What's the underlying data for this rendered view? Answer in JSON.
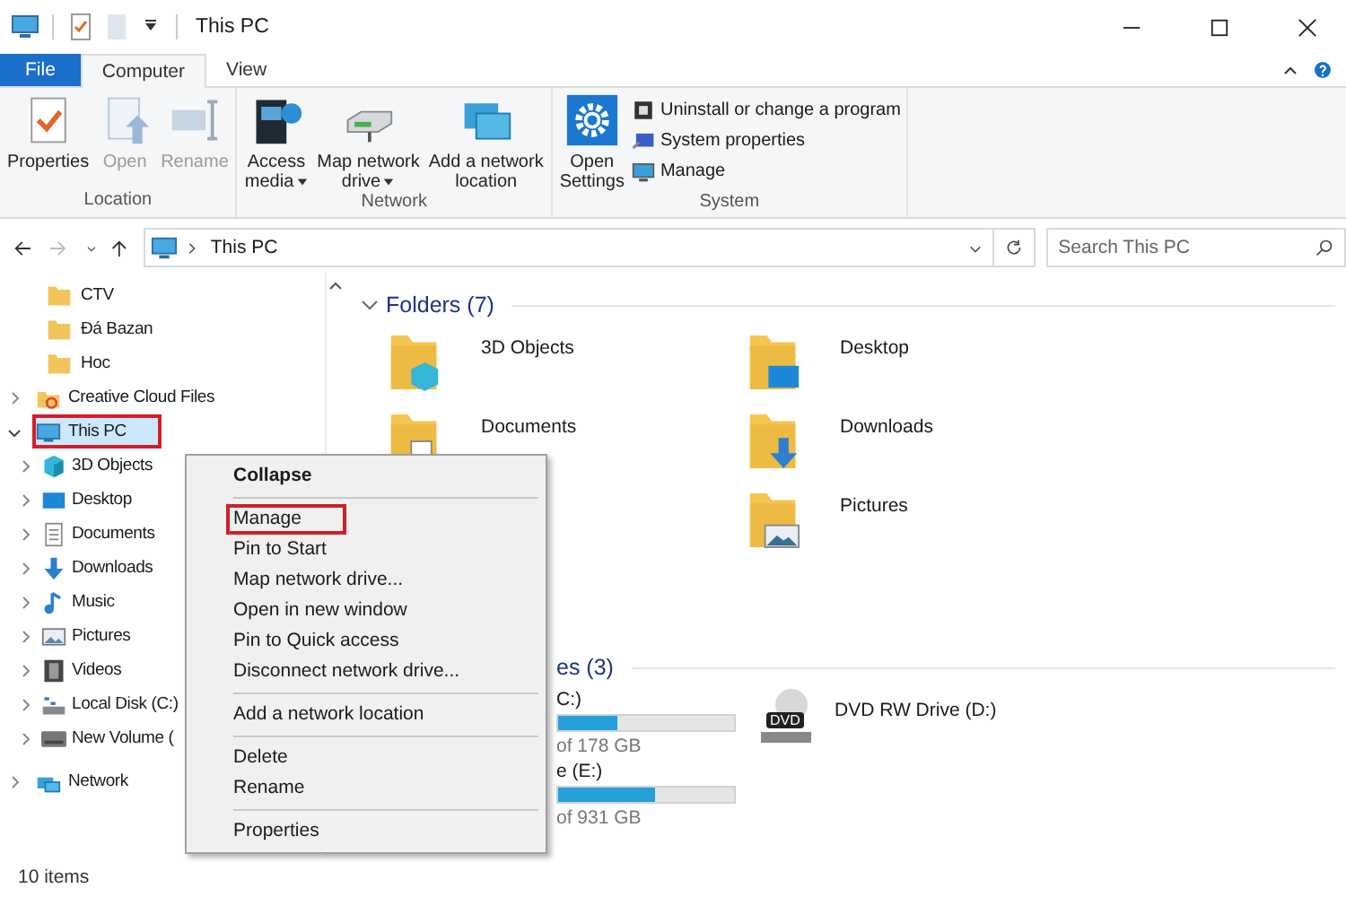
{
  "window": {
    "title": "This PC"
  },
  "ribbon_tabs": [
    {
      "label": "File",
      "kind": "file",
      "selected": false
    },
    {
      "label": "Computer",
      "kind": "tab",
      "selected": true
    },
    {
      "label": "View",
      "kind": "tab",
      "selected": false
    }
  ],
  "ribbon_groups": [
    {
      "label": "Location",
      "buttons": [
        {
          "lines": [
            "Properties"
          ],
          "disabled": false,
          "dropdown": false
        },
        {
          "lines": [
            "Open"
          ],
          "disabled": true,
          "dropdown": false
        },
        {
          "lines": [
            "Rename"
          ],
          "disabled": true,
          "dropdown": false
        }
      ]
    },
    {
      "label": "Network",
      "buttons": [
        {
          "lines": [
            "Access",
            "media"
          ],
          "disabled": false,
          "dropdown": true
        },
        {
          "lines": [
            "Map network",
            "drive"
          ],
          "disabled": false,
          "dropdown": true
        },
        {
          "lines": [
            "Add a network",
            "location"
          ],
          "disabled": false,
          "dropdown": false
        }
      ]
    },
    {
      "label": "System",
      "buttons": [
        {
          "lines": [
            "Open",
            "Settings"
          ],
          "disabled": false,
          "dropdown": false
        }
      ],
      "small_items": [
        {
          "label": "Uninstall or change a program"
        },
        {
          "label": "System properties"
        },
        {
          "label": "Manage"
        }
      ]
    }
  ],
  "address": {
    "location": "This PC"
  },
  "search": {
    "placeholder": "Search This PC"
  },
  "quick_access": [
    {
      "label": "CTV"
    },
    {
      "label": "Đá Bazan"
    },
    {
      "label": "Hoc"
    }
  ],
  "tree": [
    {
      "label": "Creative Cloud Files",
      "kind": "cloud",
      "expanded": false,
      "selected": false,
      "highlighted": false
    },
    {
      "label": "This PC",
      "kind": "pc",
      "expanded": true,
      "selected": true,
      "highlighted": true,
      "children": [
        {
          "label": "3D Objects",
          "kind": "cube",
          "expanded": false,
          "selected": false,
          "highlighted": false
        },
        {
          "label": "Desktop",
          "kind": "desktop",
          "expanded": false,
          "selected": false,
          "highlighted": false
        },
        {
          "label": "Documents",
          "kind": "doc",
          "expanded": false,
          "selected": false,
          "highlighted": false
        },
        {
          "label": "Downloads",
          "kind": "download",
          "expanded": false,
          "selected": false,
          "highlighted": false
        },
        {
          "label": "Music",
          "kind": "music",
          "expanded": false,
          "selected": false,
          "highlighted": false
        },
        {
          "label": "Pictures",
          "kind": "pictures",
          "expanded": false,
          "selected": false,
          "highlighted": false
        },
        {
          "label": "Videos",
          "kind": "video",
          "expanded": false,
          "selected": false,
          "highlighted": false
        },
        {
          "label": "Local Disk (C:)",
          "kind": "disk",
          "expanded": false,
          "selected": false,
          "highlighted": false
        },
        {
          "label": "New Volume (",
          "kind": "volume",
          "expanded": false,
          "selected": false,
          "highlighted": false
        }
      ]
    },
    {
      "label": "Network",
      "kind": "network",
      "expanded": false,
      "selected": false,
      "highlighted": false
    }
  ],
  "folders": {
    "title": "Folders (7)",
    "expanded": true,
    "columns": [
      [
        {
          "label": "3D Objects",
          "kind": "cube"
        },
        {
          "label": "Documents",
          "kind": "doc"
        }
      ],
      [
        {
          "label": "Desktop",
          "kind": "desktop"
        },
        {
          "label": "Downloads",
          "kind": "download"
        },
        {
          "label": "Pictures",
          "kind": "pictures"
        }
      ]
    ]
  },
  "devices": {
    "title": "es (3)",
    "drives": [
      {
        "label": "C:)",
        "level": 0.34,
        "caption": "of 178 GB"
      },
      {
        "label": "e (E:)",
        "level": 0.55,
        "caption": "of 931 GB"
      }
    ],
    "dvd": {
      "label": "DVD RW Drive (D:)",
      "icon_text": "DVD"
    }
  },
  "context_menu": {
    "groups": [
      [
        {
          "label": "Collapse",
          "default": true,
          "highlighted": false
        }
      ],
      [
        {
          "label": "Manage",
          "default": false,
          "highlighted": true
        },
        {
          "label": "Pin to Start",
          "default": false,
          "highlighted": false
        },
        {
          "label": "Map network drive...",
          "default": false,
          "highlighted": false
        },
        {
          "label": "Open in new window",
          "default": false,
          "highlighted": false
        },
        {
          "label": "Pin to Quick access",
          "default": false,
          "highlighted": false
        },
        {
          "label": "Disconnect network drive...",
          "default": false,
          "highlighted": false
        }
      ],
      [
        {
          "label": "Add a network location",
          "default": false,
          "highlighted": false
        }
      ],
      [
        {
          "label": "Delete",
          "default": false,
          "highlighted": false
        },
        {
          "label": "Rename",
          "default": false,
          "highlighted": false
        }
      ],
      [
        {
          "label": "Properties",
          "default": false,
          "highlighted": false
        }
      ]
    ]
  },
  "status_bar": {
    "text": "10 items"
  }
}
